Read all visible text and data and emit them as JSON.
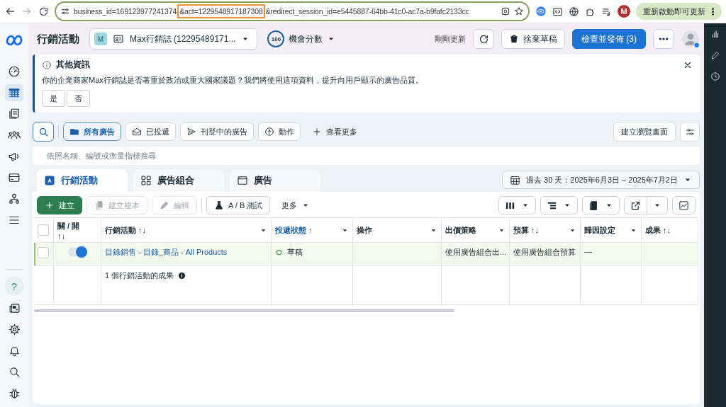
{
  "browser": {
    "address": [
      {
        "text": "business_id=169123977241374",
        "highlighted": false
      },
      {
        "text": "&act=1229548917187308",
        "highlighted": true
      },
      {
        "text": "&redirect_session_id=e5445887-64bb-41c0-ac7a-b9fafc2133cc",
        "highlighted": false
      }
    ],
    "profile_initial": "M",
    "update_button": "重新啟動即可更新"
  },
  "side_nav": {
    "items": [
      {
        "selected": false
      },
      {
        "selected": true
      },
      {
        "selected": false
      },
      {
        "selected": false
      },
      {
        "selected": false
      },
      {
        "selected": false
      },
      {
        "selected": false
      },
      {
        "selected": false
      }
    ],
    "help": "?"
  },
  "header": {
    "title": "行銷活動",
    "account": {
      "initial": "M",
      "name": "Max行銷誌 (12295489171..."
    },
    "score": {
      "value": "100",
      "label": "機會分數"
    },
    "status": "剛剛更新",
    "discard": "捨棄草稿",
    "publish": "檢查並發佈 (3)"
  },
  "notice": {
    "title": "其他資訊",
    "text": "你的企業商家Max行銷誌是否著重於政治或重大國家議題？我們將使用這項資料，提升向用戶顯示的廣告品質。",
    "buttons": [
      "是",
      "否"
    ]
  },
  "filters": {
    "items": [
      {
        "label": "所有廣告",
        "selected": true
      },
      {
        "label": "已投遞",
        "selected": false
      },
      {
        "label": "刊登中的廣告",
        "selected": false
      },
      {
        "label": "動作",
        "selected": false
      }
    ],
    "more": "查看更多",
    "create_view": "建立瀏覽畫面"
  },
  "search": {
    "placeholder": "依照名稱、編號或衡量指標搜尋"
  },
  "level_tabs": [
    {
      "label": "行銷活動",
      "selected": true
    },
    {
      "label": "廣告組合",
      "selected": false
    },
    {
      "label": "廣告",
      "selected": false
    }
  ],
  "date_range": "過去 30 天：2025年6月3日 – 2025年7月2日",
  "toolbar": [
    {
      "label": "建立",
      "kind": "primary",
      "disabled": false
    },
    {
      "label": "建立複本",
      "kind": "default",
      "disabled": true
    },
    {
      "label": "編輯",
      "kind": "default",
      "disabled": true
    },
    {
      "label": "A / B 測試",
      "kind": "default",
      "disabled": false
    },
    {
      "label": "更多",
      "kind": "menu",
      "disabled": false
    }
  ],
  "table": {
    "select_all": false,
    "columns": [
      {
        "label": "關 / 開",
        "sort": "↑↓",
        "sorted": false,
        "menu": false
      },
      {
        "label": "行銷活動",
        "sort": "↑↓",
        "sorted": false,
        "menu": true
      },
      {
        "label": "投遞狀態",
        "sort": "↑",
        "sorted": true,
        "menu": true
      },
      {
        "label": "操作",
        "sorted": false,
        "menu": true
      },
      {
        "label": "出價策略",
        "sorted": false,
        "menu": true
      },
      {
        "label": "預算",
        "sort": "↑↓",
        "sorted": false,
        "menu": true
      },
      {
        "label": "歸因設定",
        "sorted": false,
        "menu": true
      },
      {
        "label": "成果",
        "sort": "↑↓",
        "sorted": false,
        "menu": false
      }
    ],
    "rows": [
      {
        "selected": false,
        "on": true,
        "name": "目錄銷售 - 目錄_商品 - All Products",
        "status": "草稿",
        "bid_strategy": "使用廣告組合出...",
        "budget": "使用廣告組合預算",
        "attribution": "—"
      }
    ],
    "summary": "1 個行銷活動的成果"
  }
}
